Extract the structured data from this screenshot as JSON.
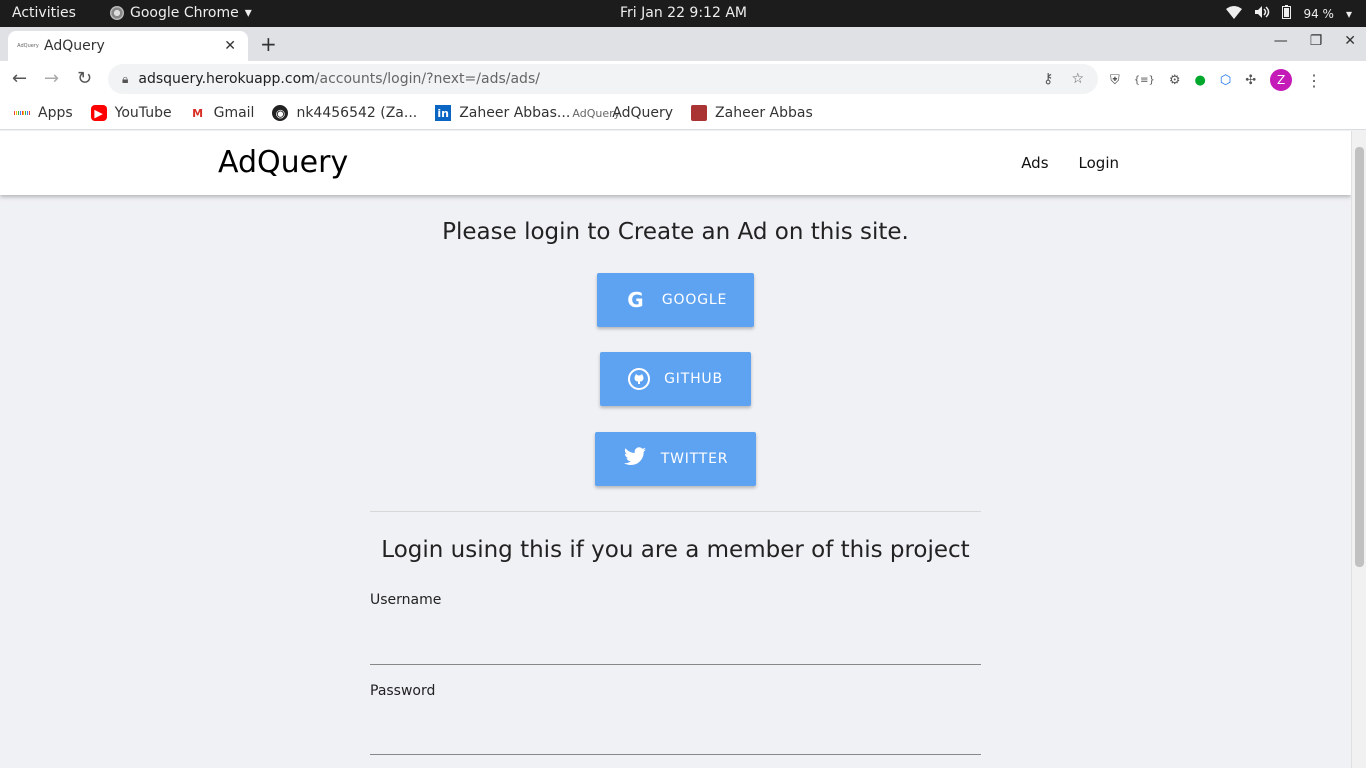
{
  "os_bar": {
    "activities": "Activities",
    "app_name": "Google Chrome",
    "clock": "Fri Jan 22   9:12 AM",
    "battery": "94 %"
  },
  "browser": {
    "tab_title": "AdQuery",
    "favicon_text": "AdQuery",
    "url_host": "adsquery.herokuapp.com",
    "url_path": "/accounts/login/?next=/ads/ads/",
    "profile_initial": "Z"
  },
  "bookmarks": [
    {
      "label": "Apps",
      "icon": "apps-grid-icon"
    },
    {
      "label": "YouTube",
      "icon": "youtube-icon"
    },
    {
      "label": "Gmail",
      "icon": "gmail-icon"
    },
    {
      "label": "nk4456542 (Za...",
      "icon": "github-icon"
    },
    {
      "label": "Zaheer Abbas...",
      "icon": "linkedin-icon"
    },
    {
      "label": "AdQuery",
      "icon": "adquery-icon"
    },
    {
      "label": "Zaheer Abbas",
      "icon": "profile-photo-icon"
    }
  ],
  "site": {
    "brand": "AdQuery",
    "nav_ads": "Ads",
    "nav_login": "Login"
  },
  "login": {
    "heading": "Please login to Create an Ad on this site.",
    "google_label": "GOOGLE",
    "github_label": "GITHUB",
    "twitter_label": "TWITTER",
    "member_heading": "Login using this if you are a member of this project",
    "username_label": "Username",
    "username_value": "",
    "password_label": "Password",
    "password_value": ""
  },
  "colors": {
    "sso_button": "#5ea2f2",
    "page_bg": "#f0f1f5",
    "avatar": "#c41ab8"
  }
}
